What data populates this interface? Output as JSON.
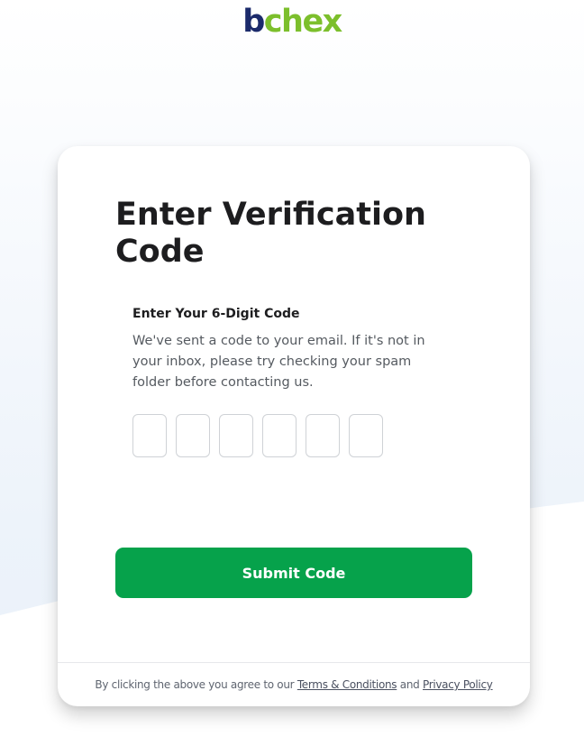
{
  "logo": {
    "first": "b",
    "rest": "chex"
  },
  "colors": {
    "logo_dark": "#1b2a6b",
    "logo_green": "#7cbf2c",
    "button_green": "#06a24b"
  },
  "card": {
    "title": "Enter Verification Code",
    "section_label": "Enter Your 6-Digit Code",
    "helper_text": "We've sent a code to your email. If it's not in your inbox, please try checking your spam folder before contacting us.",
    "code_digits": [
      "",
      "",
      "",
      "",
      "",
      ""
    ],
    "submit_label": "Submit Code",
    "footer": {
      "prefix": "By clicking the above you agree to our ",
      "terms_link": "Terms & Conditions",
      "conjunction": " and ",
      "privacy_link": "Privacy Policy"
    }
  }
}
